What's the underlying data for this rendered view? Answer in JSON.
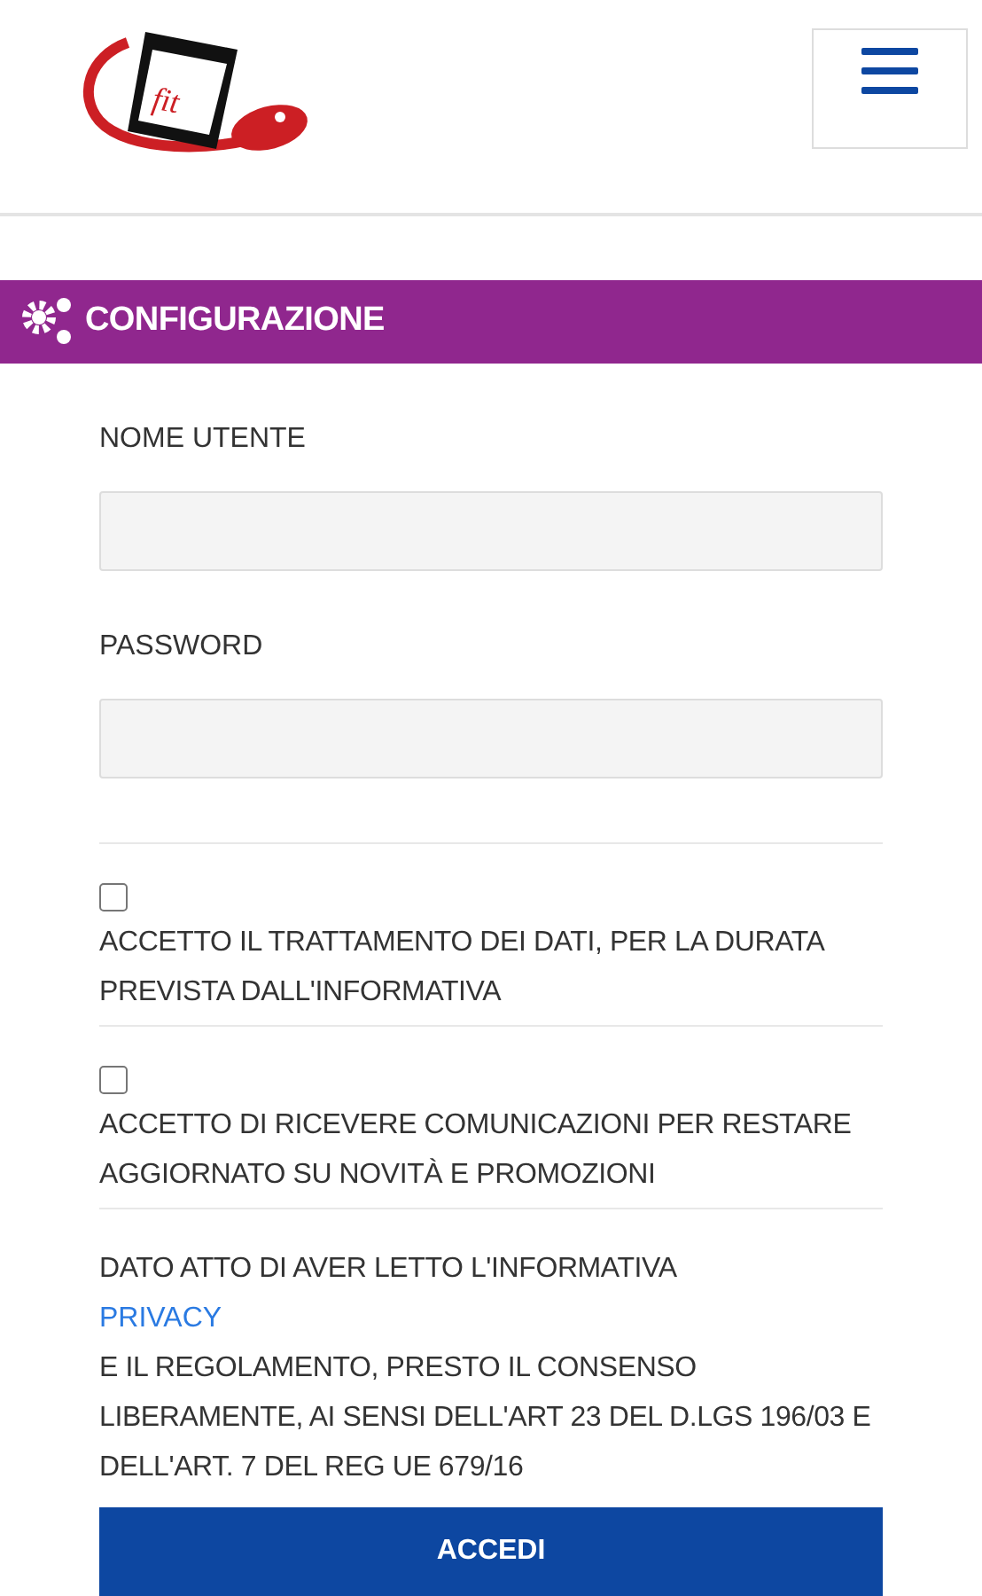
{
  "logo": {
    "text": "fit"
  },
  "section": {
    "title": "CONFIGURAZIONE"
  },
  "fields": [
    {
      "label": "NOME UTENTE"
    },
    {
      "label": "PASSWORD"
    }
  ],
  "consents": [
    {
      "text": "ACCETTO IL TRATTAMENTO DEI DATI, PER LA DURATA PREVISTA DALL'INFORMATIVA",
      "checked": false
    },
    {
      "text": "ACCETTO DI RICEVERE COMUNICAZIONI PER RESTARE AGGIORNATO SU NOVITÀ E PROMOZIONI",
      "checked": false
    }
  ],
  "notice": {
    "before": "DATO ATTO DI AVER LETTO L'INFORMATIVA",
    "link": "PRIVACY",
    "after": "E IL REGOLAMENTO, PRESTO IL CONSENSO LIBERAMENTE, AI SENSI DELL'ART 23 DEL D.LGS 196/03 E DELL'ART. 7 DEL REG UE 679/16"
  },
  "button": {
    "label": "ACCEDI"
  }
}
